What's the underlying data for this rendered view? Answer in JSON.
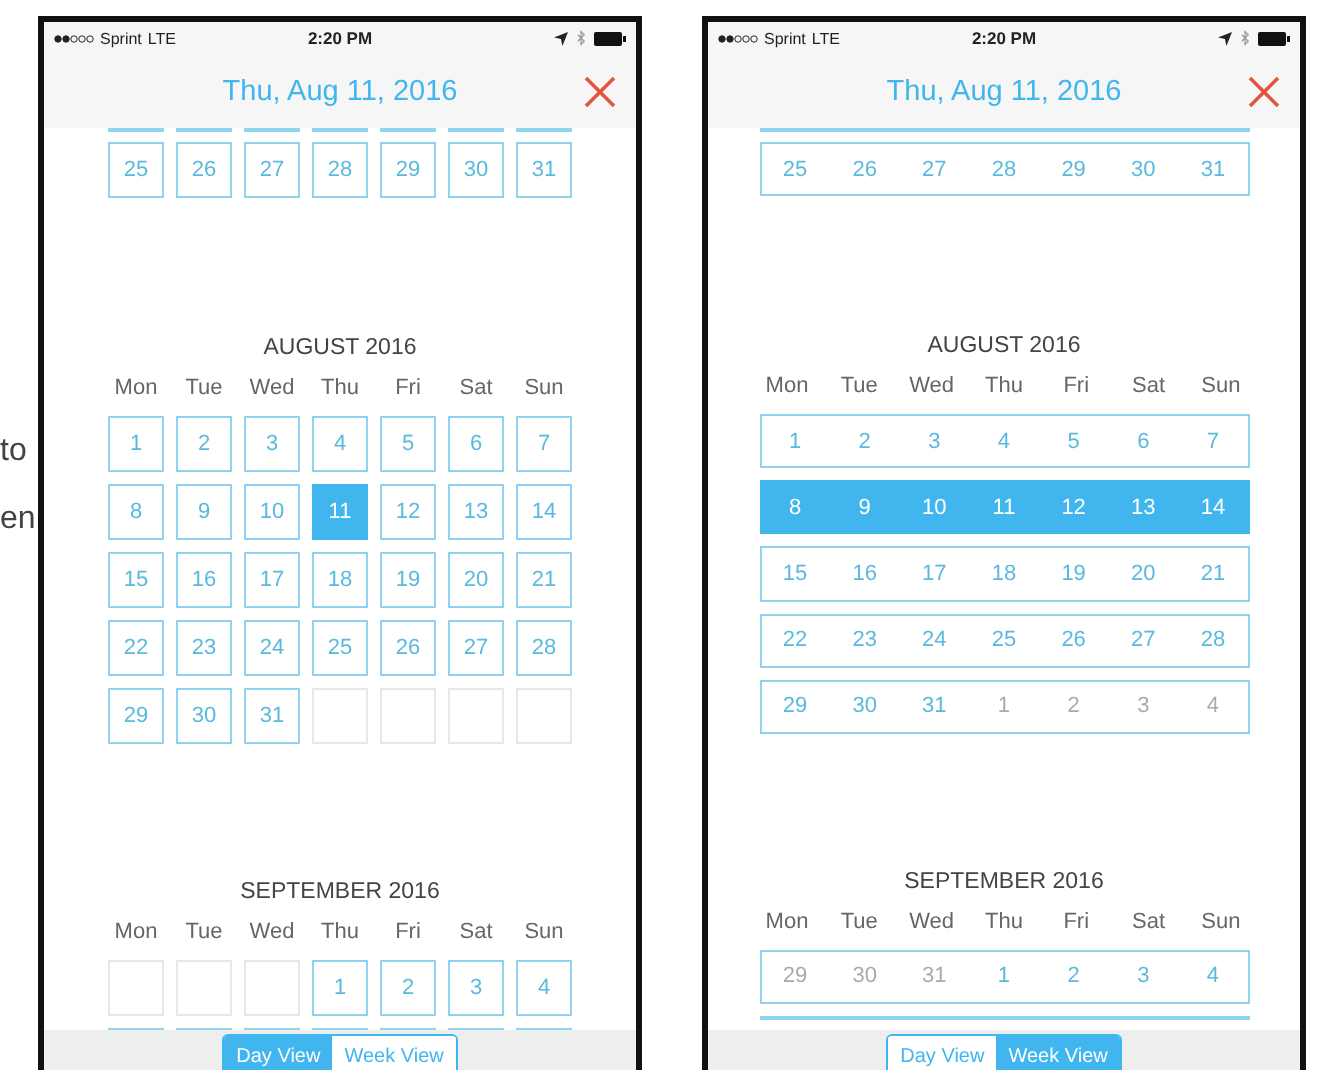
{
  "side_text": [
    "to",
    "en"
  ],
  "screens": [
    {
      "kind": "day-grid",
      "status_bar": {
        "carrier": "Sprint",
        "network": "LTE",
        "time": "2:20 PM"
      },
      "header": {
        "title": "Thu, Aug 11, 2016"
      },
      "top_row": {
        "days": [
          {
            "kind": "day",
            "label": "25",
            "selected": false
          },
          {
            "kind": "day",
            "label": "26",
            "selected": false
          },
          {
            "kind": "day",
            "label": "27",
            "selected": false
          },
          {
            "kind": "day",
            "label": "28",
            "selected": false
          },
          {
            "kind": "day",
            "label": "29",
            "selected": false
          },
          {
            "kind": "day",
            "label": "30",
            "selected": false
          },
          {
            "kind": "day",
            "label": "31",
            "selected": false
          }
        ]
      },
      "months": [
        {
          "title": "AUGUST 2016",
          "weekdays": [
            "Mon",
            "Tue",
            "Wed",
            "Thu",
            "Fri",
            "Sat",
            "Sun"
          ],
          "weeks": [
            {
              "days": [
                {
                  "kind": "day",
                  "label": "1",
                  "selected": false
                },
                {
                  "kind": "day",
                  "label": "2",
                  "selected": false
                },
                {
                  "kind": "day",
                  "label": "3",
                  "selected": false
                },
                {
                  "kind": "day",
                  "label": "4",
                  "selected": false
                },
                {
                  "kind": "day",
                  "label": "5",
                  "selected": false
                },
                {
                  "kind": "day",
                  "label": "6",
                  "selected": false
                },
                {
                  "kind": "day",
                  "label": "7",
                  "selected": false
                }
              ]
            },
            {
              "days": [
                {
                  "kind": "day",
                  "label": "8",
                  "selected": false
                },
                {
                  "kind": "day",
                  "label": "9",
                  "selected": false
                },
                {
                  "kind": "day",
                  "label": "10",
                  "selected": false
                },
                {
                  "kind": "day",
                  "label": "11",
                  "selected": true
                },
                {
                  "kind": "day",
                  "label": "12",
                  "selected": false
                },
                {
                  "kind": "day",
                  "label": "13",
                  "selected": false
                },
                {
                  "kind": "day",
                  "label": "14",
                  "selected": false
                }
              ]
            },
            {
              "days": [
                {
                  "kind": "day",
                  "label": "15",
                  "selected": false
                },
                {
                  "kind": "day",
                  "label": "16",
                  "selected": false
                },
                {
                  "kind": "day",
                  "label": "17",
                  "selected": false
                },
                {
                  "kind": "day",
                  "label": "18",
                  "selected": false
                },
                {
                  "kind": "day",
                  "label": "19",
                  "selected": false
                },
                {
                  "kind": "day",
                  "label": "20",
                  "selected": false
                },
                {
                  "kind": "day",
                  "label": "21",
                  "selected": false
                }
              ]
            },
            {
              "days": [
                {
                  "kind": "day",
                  "label": "22",
                  "selected": false
                },
                {
                  "kind": "day",
                  "label": "23",
                  "selected": false
                },
                {
                  "kind": "day",
                  "label": "24",
                  "selected": false
                },
                {
                  "kind": "day",
                  "label": "25",
                  "selected": false
                },
                {
                  "kind": "day",
                  "label": "26",
                  "selected": false
                },
                {
                  "kind": "day",
                  "label": "27",
                  "selected": false
                },
                {
                  "kind": "day",
                  "label": "28",
                  "selected": false
                }
              ]
            },
            {
              "days": [
                {
                  "kind": "day",
                  "label": "29",
                  "selected": false
                },
                {
                  "kind": "day",
                  "label": "30",
                  "selected": false
                },
                {
                  "kind": "day",
                  "label": "31",
                  "selected": false
                },
                {
                  "kind": "empty"
                },
                {
                  "kind": "empty"
                },
                {
                  "kind": "empty"
                },
                {
                  "kind": "empty"
                }
              ]
            }
          ]
        },
        {
          "title": "SEPTEMBER 2016",
          "weekdays": [
            "Mon",
            "Tue",
            "Wed",
            "Thu",
            "Fri",
            "Sat",
            "Sun"
          ],
          "weeks": [
            {
              "days": [
                {
                  "kind": "empty"
                },
                {
                  "kind": "empty"
                },
                {
                  "kind": "empty"
                },
                {
                  "kind": "day",
                  "label": "1",
                  "selected": false
                },
                {
                  "kind": "day",
                  "label": "2",
                  "selected": false
                },
                {
                  "kind": "day",
                  "label": "3",
                  "selected": false
                },
                {
                  "kind": "day",
                  "label": "4",
                  "selected": false
                }
              ]
            }
          ]
        }
      ],
      "segments": [
        {
          "label": "Day View",
          "selected": true
        },
        {
          "label": "Week View",
          "selected": false
        }
      ]
    },
    {
      "kind": "week-grid",
      "status_bar": {
        "carrier": "Sprint",
        "network": "LTE",
        "time": "2:20 PM"
      },
      "header": {
        "title": "Thu, Aug 11, 2016"
      },
      "top_row": {
        "selected": false,
        "days": [
          {
            "kind": "day",
            "label": "25"
          },
          {
            "kind": "day",
            "label": "26"
          },
          {
            "kind": "day",
            "label": "27"
          },
          {
            "kind": "day",
            "label": "28"
          },
          {
            "kind": "day",
            "label": "29"
          },
          {
            "kind": "day",
            "label": "30"
          },
          {
            "kind": "day",
            "label": "31"
          }
        ]
      },
      "months": [
        {
          "title": "AUGUST 2016",
          "weekdays": [
            "Mon",
            "Tue",
            "Wed",
            "Thu",
            "Fri",
            "Sat",
            "Sun"
          ],
          "weeks": [
            {
              "selected": false,
              "days": [
                {
                  "kind": "day",
                  "label": "1"
                },
                {
                  "kind": "day",
                  "label": "2"
                },
                {
                  "kind": "day",
                  "label": "3"
                },
                {
                  "kind": "day",
                  "label": "4"
                },
                {
                  "kind": "day",
                  "label": "5"
                },
                {
                  "kind": "day",
                  "label": "6"
                },
                {
                  "kind": "day",
                  "label": "7"
                }
              ]
            },
            {
              "selected": true,
              "days": [
                {
                  "kind": "day",
                  "label": "8"
                },
                {
                  "kind": "day",
                  "label": "9"
                },
                {
                  "kind": "day",
                  "label": "10"
                },
                {
                  "kind": "day",
                  "label": "11"
                },
                {
                  "kind": "day",
                  "label": "12"
                },
                {
                  "kind": "day",
                  "label": "13"
                },
                {
                  "kind": "day",
                  "label": "14"
                }
              ]
            },
            {
              "selected": false,
              "days": [
                {
                  "kind": "day",
                  "label": "15"
                },
                {
                  "kind": "day",
                  "label": "16"
                },
                {
                  "kind": "day",
                  "label": "17"
                },
                {
                  "kind": "day",
                  "label": "18"
                },
                {
                  "kind": "day",
                  "label": "19"
                },
                {
                  "kind": "day",
                  "label": "20"
                },
                {
                  "kind": "day",
                  "label": "21"
                }
              ]
            },
            {
              "selected": false,
              "days": [
                {
                  "kind": "day",
                  "label": "22"
                },
                {
                  "kind": "day",
                  "label": "23"
                },
                {
                  "kind": "day",
                  "label": "24"
                },
                {
                  "kind": "day",
                  "label": "25"
                },
                {
                  "kind": "day",
                  "label": "26"
                },
                {
                  "kind": "day",
                  "label": "27"
                },
                {
                  "kind": "day",
                  "label": "28"
                }
              ]
            },
            {
              "selected": false,
              "days": [
                {
                  "kind": "day",
                  "label": "29"
                },
                {
                  "kind": "day",
                  "label": "30"
                },
                {
                  "kind": "day",
                  "label": "31"
                },
                {
                  "kind": "other",
                  "label": "1"
                },
                {
                  "kind": "other",
                  "label": "2"
                },
                {
                  "kind": "other",
                  "label": "3"
                },
                {
                  "kind": "other",
                  "label": "4"
                }
              ]
            }
          ]
        },
        {
          "title": "SEPTEMBER 2016",
          "weekdays": [
            "Mon",
            "Tue",
            "Wed",
            "Thu",
            "Fri",
            "Sat",
            "Sun"
          ],
          "weeks": [
            {
              "selected": false,
              "days": [
                {
                  "kind": "other",
                  "label": "29"
                },
                {
                  "kind": "other",
                  "label": "30"
                },
                {
                  "kind": "other",
                  "label": "31"
                },
                {
                  "kind": "day",
                  "label": "1"
                },
                {
                  "kind": "day",
                  "label": "2"
                },
                {
                  "kind": "day",
                  "label": "3"
                },
                {
                  "kind": "day",
                  "label": "4"
                }
              ]
            }
          ]
        }
      ],
      "segments": [
        {
          "label": "Day View",
          "selected": false
        },
        {
          "label": "Week View",
          "selected": true
        }
      ]
    }
  ]
}
